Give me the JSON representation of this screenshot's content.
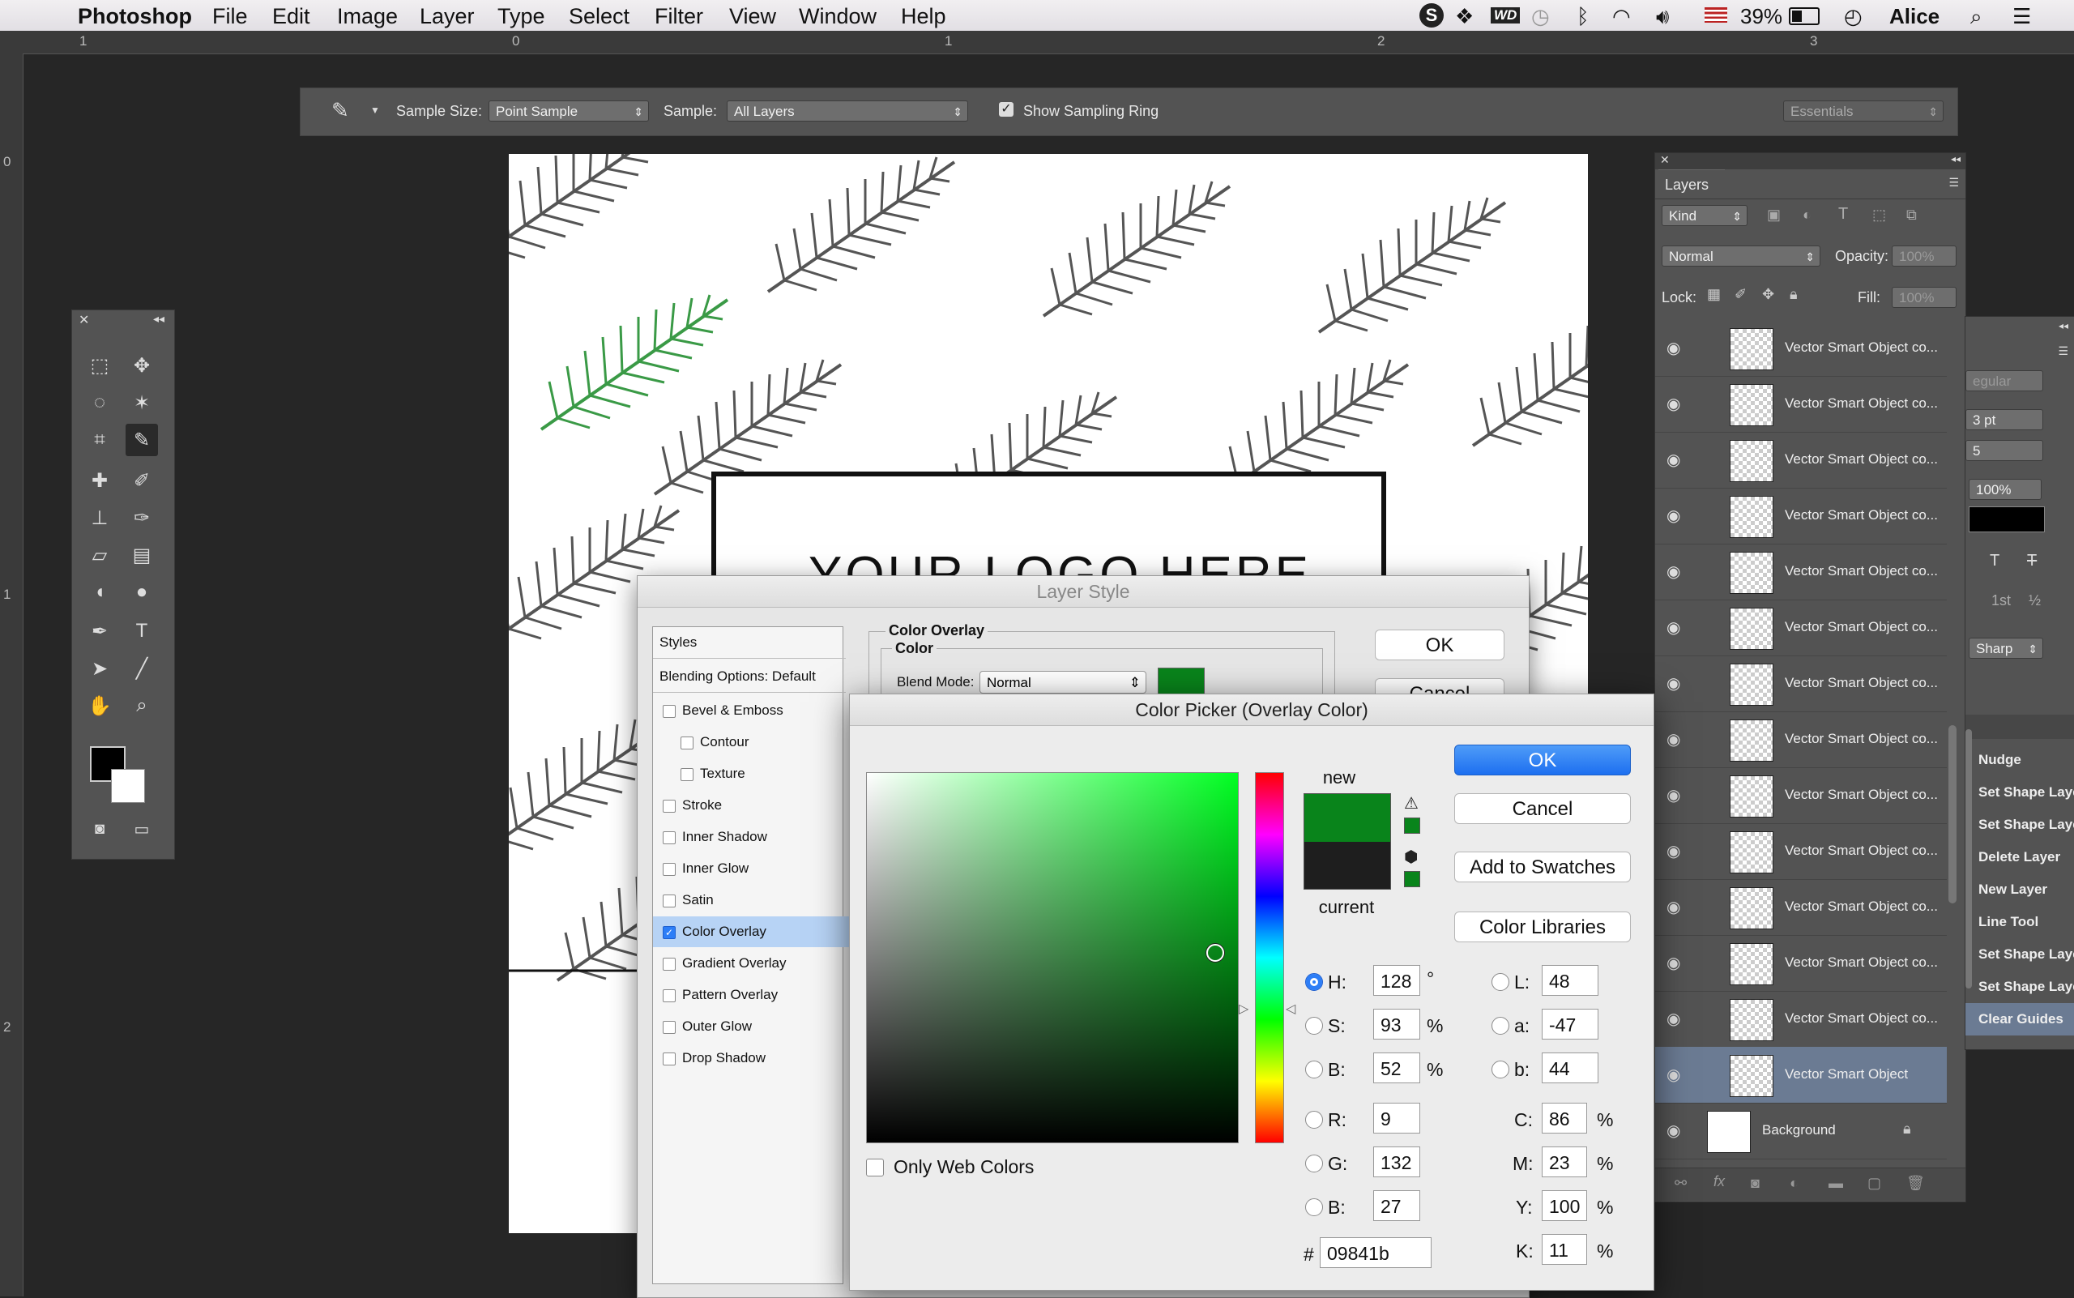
{
  "menubar": {
    "app": "Photoshop",
    "items": [
      "File",
      "Edit",
      "Image",
      "Layer",
      "Type",
      "Select",
      "Filter",
      "View",
      "Window",
      "Help"
    ],
    "battery": "39%",
    "user": "Alice"
  },
  "rulers": {
    "h": [
      "1",
      "0",
      "1",
      "2",
      "3"
    ],
    "v": [
      "0",
      "1",
      "2"
    ]
  },
  "options": {
    "sample_size_label": "Sample Size:",
    "sample_size_value": "Point Sample",
    "sample_label": "Sample:",
    "sample_value": "All Layers",
    "show_ring": "Show Sampling Ring",
    "workspace": "Essentials"
  },
  "canvas": {
    "logo_text": "YOUR LOGO HERE"
  },
  "layers": {
    "title": "Layers",
    "kind": "Kind",
    "blend": "Normal",
    "opacity_label": "Opacity:",
    "opacity_value": "100%",
    "lock_label": "Lock:",
    "fill_label": "Fill:",
    "fill_value": "100%",
    "rows": [
      "Vector Smart Object co...",
      "Vector Smart Object co...",
      "Vector Smart Object co...",
      "Vector Smart Object co...",
      "Vector Smart Object co...",
      "Vector Smart Object co...",
      "Vector Smart Object co...",
      "Vector Smart Object co...",
      "Vector Smart Object co...",
      "Vector Smart Object co...",
      "Vector Smart Object co...",
      "Vector Smart Object co...",
      "Vector Smart Object co..."
    ],
    "selected": "Vector Smart Object",
    "background": "Background"
  },
  "char_panel": {
    "style": "egular",
    "size": "3 pt",
    "leading": "5",
    "scale": "100%",
    "aa": "Sharp"
  },
  "history": {
    "items": [
      "Nudge",
      "Set Shape Laye",
      "Set Shape Laye",
      "Delete Layer",
      "New Layer",
      "Line Tool",
      "Set Shape Laye",
      "Set Shape Laye",
      "Clear Guides"
    ]
  },
  "layer_style": {
    "title": "Layer Style",
    "styles_header": "Styles",
    "blending": "Blending Options: Default",
    "items": [
      {
        "label": "Bevel & Emboss",
        "indent": false,
        "checked": false
      },
      {
        "label": "Contour",
        "indent": true,
        "checked": false
      },
      {
        "label": "Texture",
        "indent": true,
        "checked": false
      },
      {
        "label": "Stroke",
        "indent": false,
        "checked": false
      },
      {
        "label": "Inner Shadow",
        "indent": false,
        "checked": false
      },
      {
        "label": "Inner Glow",
        "indent": false,
        "checked": false
      },
      {
        "label": "Satin",
        "indent": false,
        "checked": false
      },
      {
        "label": "Color Overlay",
        "indent": false,
        "checked": true
      },
      {
        "label": "Gradient Overlay",
        "indent": false,
        "checked": false
      },
      {
        "label": "Pattern Overlay",
        "indent": false,
        "checked": false
      },
      {
        "label": "Outer Glow",
        "indent": false,
        "checked": false
      },
      {
        "label": "Drop Shadow",
        "indent": false,
        "checked": false
      }
    ],
    "section": "Color Overlay",
    "subsection": "Color",
    "blend_label": "Blend Mode:",
    "blend_value": "Normal",
    "ok": "OK",
    "cancel": "Cancel",
    "swatch_color": "#09841b"
  },
  "picker": {
    "title": "Color Picker (Overlay Color)",
    "ok": "OK",
    "cancel": "Cancel",
    "add_swatches": "Add to Swatches",
    "libraries": "Color Libraries",
    "new_label": "new",
    "current_label": "current",
    "new_color": "#09841b",
    "current_color": "#1e1e1e",
    "only_web": "Only Web Colors",
    "hsb": {
      "H": "128",
      "S": "93",
      "B": "52"
    },
    "rgb": {
      "R": "9",
      "G": "132",
      "B": "27"
    },
    "lab": {
      "L": "48",
      "a": "-47",
      "b": "44"
    },
    "cmyk": {
      "C": "86",
      "M": "23",
      "Y": "100",
      "K": "11"
    },
    "hex": "09841b",
    "deg": "°",
    "pct": "%"
  }
}
